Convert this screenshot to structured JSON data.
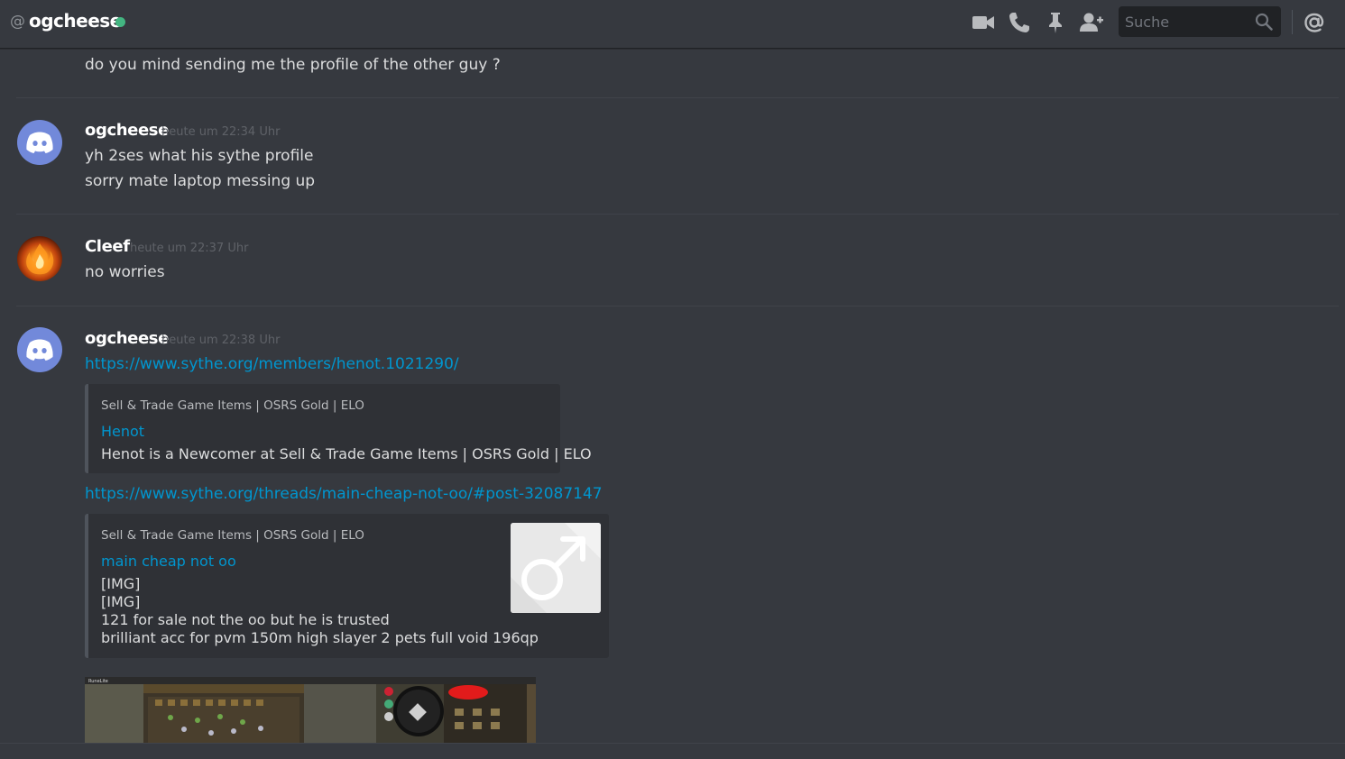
{
  "header": {
    "at_symbol": "@",
    "channel_name": "ogcheese",
    "status_color": "#43b581",
    "search_placeholder": "Suche",
    "icons": [
      "video-camera-icon",
      "phone-icon",
      "pin-icon",
      "add-friend-icon",
      "search-icon",
      "mention-icon"
    ]
  },
  "messages": [
    {
      "continued_lines": [
        "do you mind sending me the profile of the other guy ?"
      ]
    },
    {
      "author": "ogcheese",
      "avatar": "discord-default-avatar",
      "timestamp": "heute um 22:34 Uhr",
      "lines": [
        "yh 2ses what his sythe profile",
        "sorry mate laptop messing up"
      ]
    },
    {
      "author": "Cleef",
      "avatar": "fire-avatar",
      "timestamp": "heute um 22:37 Uhr",
      "lines": [
        "no worries"
      ]
    },
    {
      "author": "ogcheese",
      "avatar": "discord-default-avatar",
      "timestamp": "heute um 22:38 Uhr",
      "link1": "https://www.sythe.org/members/henot.1021290/",
      "embed1": {
        "provider": "Sell & Trade Game Items | OSRS Gold | ELO",
        "title": "Henot",
        "description": "Henot is a Newcomer at Sell & Trade Game Items | OSRS Gold | ELO"
      },
      "link2": "https://www.sythe.org/threads/main-cheap-not-oo/#post-32087147",
      "embed2": {
        "provider": "Sell & Trade Game Items | OSRS Gold | ELO",
        "title": "main cheap not oo",
        "description_lines": [
          "[IMG]",
          "[IMG]",
          "121 for sale not the oo but he is trusted",
          "brilliant acc for pvm 150m high slayer 2 pets full void 196qp"
        ],
        "thumbnail": "male-symbol-icon"
      },
      "attachment": "runelite-game-screenshot"
    }
  ],
  "colors": {
    "background": "#36393f",
    "link": "#0096cf",
    "embed_bg": "#2f3136",
    "embed_border": "#4f545c",
    "blurple": "#7289da"
  }
}
